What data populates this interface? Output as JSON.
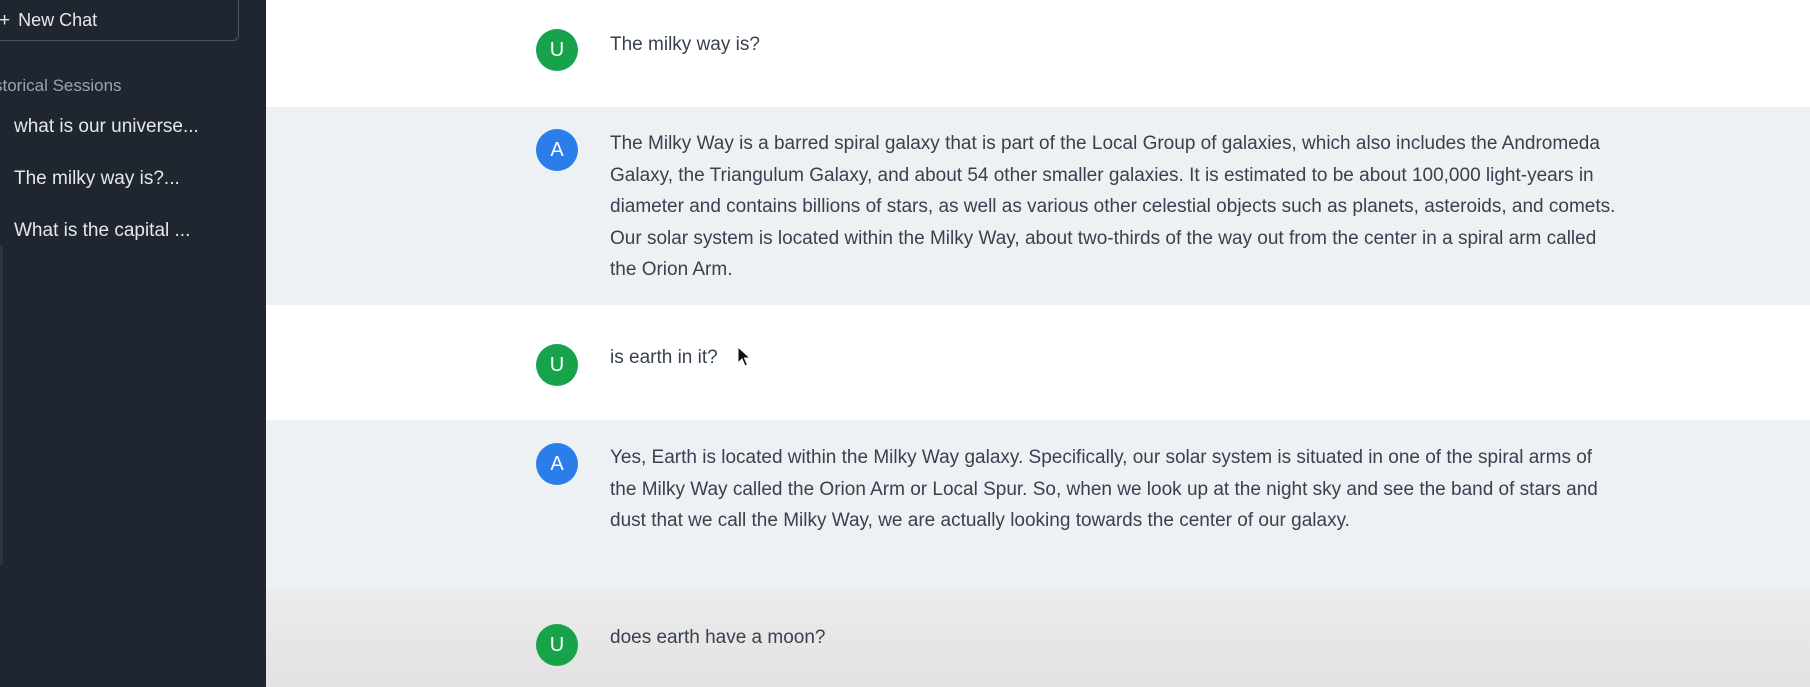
{
  "sidebar": {
    "new_chat_label": "New Chat",
    "plus_icon": "+",
    "sessions_heading": "storical Sessions",
    "sessions": [
      {
        "label": "what is our universe..."
      },
      {
        "label": "The milky way is?..."
      },
      {
        "label": "What is the capital ..."
      }
    ]
  },
  "messages": [
    {
      "role": "user",
      "avatar": "U",
      "text": "The milky way is?"
    },
    {
      "role": "assistant",
      "avatar": "A",
      "text": "The Milky Way is a barred spiral galaxy that is part of the Local Group of galaxies, which also includes the Andromeda Galaxy, the Triangulum Galaxy, and about 54 other smaller galaxies. It is estimated to be about 100,000 light-years in diameter and contains billions of stars, as well as various other celestial objects such as planets, asteroids, and comets. Our solar system is located within the Milky Way, about two-thirds of the way out from the center in a spiral arm called the Orion Arm."
    },
    {
      "role": "user",
      "avatar": "U",
      "text": "is earth in it?"
    },
    {
      "role": "assistant",
      "avatar": "A",
      "text": "Yes, Earth is located within the Milky Way galaxy. Specifically, our solar system is situated in one of the spiral arms of the Milky Way called the Orion Arm or Local Spur. So, when we look up at the night sky and see the band of stars and dust that we call the Milky Way, we are actually looking towards the center of our galaxy."
    },
    {
      "role": "user",
      "avatar": "U",
      "text": "does earth have a moon?"
    }
  ],
  "colors": {
    "sidebar_bg": "#1f2630",
    "user_avatar": "#16a34a",
    "assistant_avatar": "#2b7de9",
    "assistant_row_bg": "#eef1f3"
  }
}
